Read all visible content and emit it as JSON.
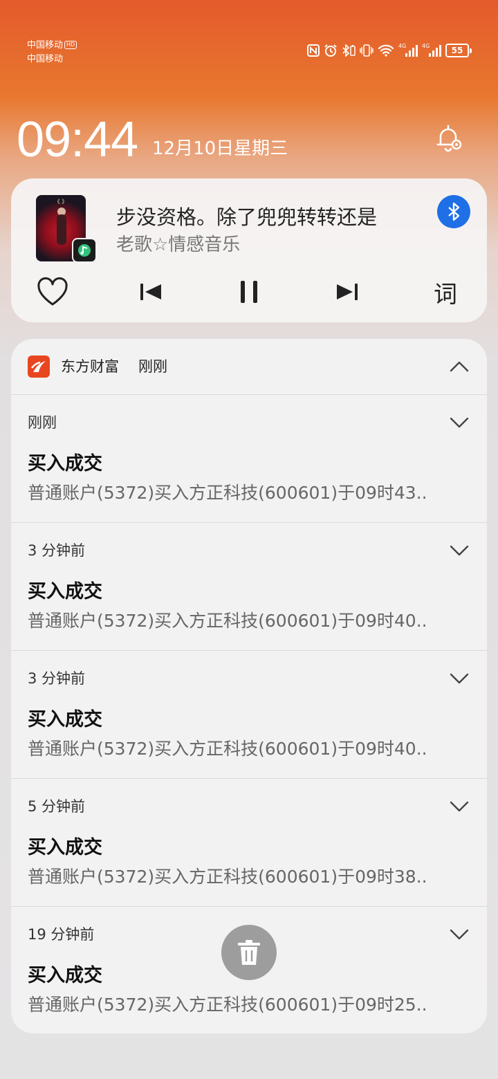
{
  "status_bar": {
    "carrier_1": "中国移动",
    "carrier_1_badge": "HD",
    "carrier_2": "中国移动",
    "net_1": "4G",
    "net_2": "4G",
    "battery": "55",
    "icons": [
      "nfc-icon",
      "alarm-icon",
      "bluetooth-icon",
      "vibrate-icon",
      "wifi-icon",
      "signal-icon",
      "signal-icon",
      "battery-icon"
    ]
  },
  "clock": {
    "time": "09:44",
    "date": "12月10日星期三"
  },
  "music": {
    "song": "步没资格。除了兜兜转转还是",
    "artist": "老歌☆情感音乐",
    "lyrics_button": "词",
    "accent": "#1f6fe6"
  },
  "notification": {
    "app_name": "东方财富",
    "time": "刚刚",
    "app_color": "#e8461f",
    "items": [
      {
        "time": "刚刚",
        "title": "买入成交",
        "body": "普通账户(5372)买入方正科技(600601)于09时43.."
      },
      {
        "time": "3 分钟前",
        "title": "买入成交",
        "body": "普通账户(5372)买入方正科技(600601)于09时40.."
      },
      {
        "time": "3 分钟前",
        "title": "买入成交",
        "body": "普通账户(5372)买入方正科技(600601)于09时40.."
      },
      {
        "time": "5 分钟前",
        "title": "买入成交",
        "body": "普通账户(5372)买入方正科技(600601)于09时38.."
      },
      {
        "time": "19 分钟前",
        "title": "买入成交",
        "body": "普通账户(5372)买入方正科技(600601)于09时25.."
      }
    ]
  }
}
